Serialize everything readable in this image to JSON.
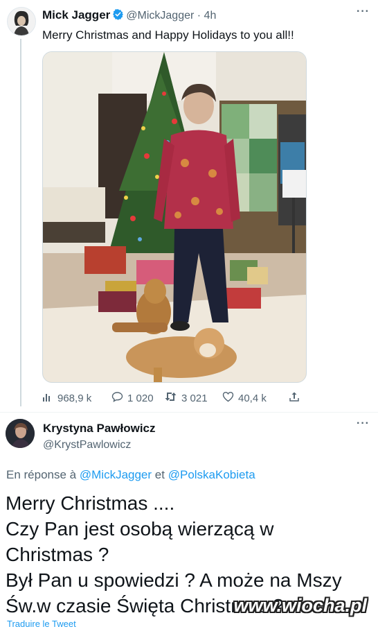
{
  "tweet": {
    "author_name": "Mick Jagger",
    "author_handle": "@MickJagger",
    "separator": "·",
    "time": "4h",
    "menu": "···",
    "text": "Merry Christmas and Happy Holidays to you all!!",
    "stats": {
      "views": "968,9 k",
      "replies": "1 020",
      "retweets": "3 021",
      "likes": "40,4 k"
    }
  },
  "reply": {
    "author_name": "Krystyna Pawłowicz",
    "author_handle": "@KrystPawlowicz",
    "menu": "···",
    "reply_prefix": "En réponse à",
    "mention_1": "@MickJagger",
    "reply_conj": "et",
    "mention_2": "@PolskaKobieta",
    "lines": [
      "Merry Christmas ....",
      "Czy Pan jest osobą wierzącą w",
      "Christmas ?",
      "Był Pan u spowiedzi ? A może na Mszy",
      "Św.w czasie Święta Christmas ?"
    ],
    "translate": "Traduire le Tweet"
  },
  "watermark": "www.wiocha.pl",
  "colors": {
    "accent": "#1d9bf0",
    "muted": "#536471",
    "verified": "#1d9bf0"
  },
  "icons": [
    "views-icon",
    "reply-icon",
    "retweet-icon",
    "like-icon",
    "share-icon",
    "verified-icon"
  ]
}
